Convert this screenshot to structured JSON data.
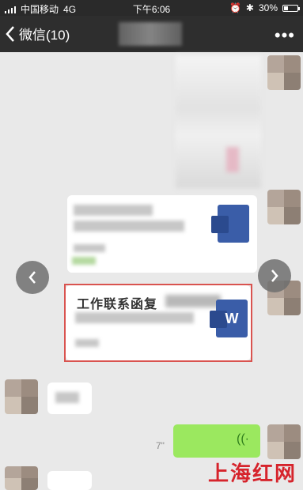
{
  "status_bar": {
    "carrier": "中国移动",
    "network": "4G",
    "time": "下午6:06",
    "battery": "30%",
    "battery_level": 0.3
  },
  "nav": {
    "back_label": "微信(10)",
    "more_label": "•••"
  },
  "messages": {
    "doc_card": {
      "title_prefix": "工作联系函复",
      "icon_letter": "W"
    },
    "voice": {
      "duration": "7\""
    }
  },
  "watermark": "上海红网",
  "colors": {
    "accent_red": "#d9534f",
    "voice_green": "#9be85f",
    "word_blue": "#3a5da8"
  },
  "icons": {
    "back": "chevron-left-icon",
    "more": "more-dots-icon",
    "prev": "chevron-left-icon",
    "next": "chevron-right-icon",
    "sound": "sound-wave-icon",
    "word": "word-doc-icon"
  }
}
